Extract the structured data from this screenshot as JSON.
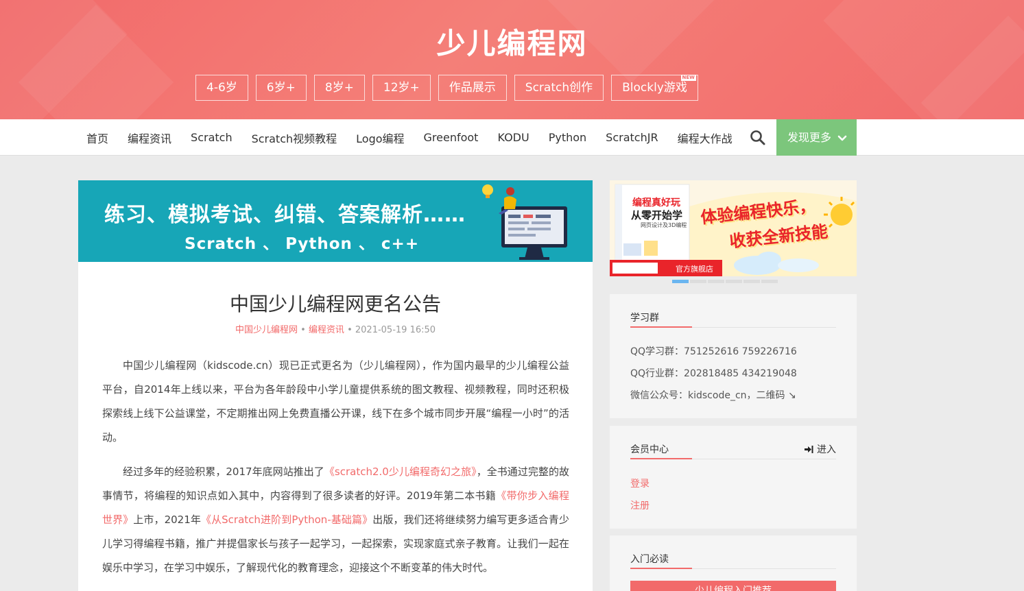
{
  "header": {
    "title": "少儿编程网",
    "age_tabs": [
      {
        "label": "4-6岁"
      },
      {
        "label": "6岁+"
      },
      {
        "label": "8岁+"
      },
      {
        "label": "12岁+"
      },
      {
        "label": "作品展示"
      },
      {
        "label": "Scratch创作"
      },
      {
        "label": "Blockly游戏",
        "badge": "NEW"
      }
    ]
  },
  "nav": {
    "items": [
      "首页",
      "编程资讯",
      "Scratch",
      "Scratch视频教程",
      "Logo编程",
      "Greenfoot",
      "KODU",
      "Python",
      "ScratchJR",
      "编程大作战"
    ],
    "search_icon": "search-icon",
    "discover_label": "发现更多",
    "discover_color": "#7cc67c"
  },
  "banner": {
    "line1": "练习、模拟考试、纠错、答案解析……",
    "line2": "Scratch 、 Python 、 c++",
    "bg_color": "#17a6b7"
  },
  "article": {
    "title": "中国少儿编程网更名公告",
    "meta": {
      "author": "中国少儿编程网",
      "sep": "•",
      "category": "编程资讯",
      "date": "2021-05-19 16:50"
    },
    "p1": "中国少儿编程网（kidscode.cn）现已正式更名为（少儿编程网），作为国内最早的少儿编程公益平台，自2014年上线以来，平台为各年龄段中小学儿童提供系统的图文教程、视频教程，同时还积极探索线上线下公益课堂，不定期推出网上免费直播公开课，线下在多个城市同步开展“编程一小时”的活动。",
    "p2": {
      "t1": "经过多年的经验积累，2017年底网站推出了",
      "b1": "《scratch2.0少儿编程奇幻之旅》",
      "t2": "，全书通过完整的故事情节，将编程的知识点如入其中，内容得到了很多读者的好评。2019年第二本书籍",
      "b2": "《带你步入编程世界》",
      "t3": "上市，2021年",
      "b3": "《从Scratch进阶到Python-基础篇》",
      "t4": "出版，我们还将继续努力编写更多适合青少儿学习得编程书籍，推广并提倡家长与孩子一起学习，一起探索，实现家庭式亲子教育。让我们一起在娱乐中学习，在学习中娱乐，了解现代化的教育理念，迎接这个不断变革的伟大时代。"
    }
  },
  "ad": {
    "book_title_1": "编程真好玩",
    "book_title_2": "从零开始学",
    "book_subtitle": "网页设计及3D编程",
    "slogan_1": "体验编程快乐，",
    "slogan_2": "收获全新技能",
    "store": "官方旗舰店",
    "slides": 6,
    "active_slide": 1
  },
  "widgets": {
    "study_group": {
      "title": "学习群",
      "qq_study": "QQ学习群：751252616 759226716",
      "qq_industry": "QQ行业群：202818485 434219048",
      "wechat": "微信公众号：kidscode_cn，二维码 ↘"
    },
    "member": {
      "title": "会员中心",
      "enter": "进入",
      "login": "登录",
      "register": "注册"
    },
    "intro": {
      "title": "入门必读",
      "button": "少儿编程入门推荐"
    }
  },
  "colors": {
    "header_red": "#f26a6a",
    "link_red": "#f26a6a",
    "green": "#7cc67c",
    "teal": "#17a6b7"
  }
}
